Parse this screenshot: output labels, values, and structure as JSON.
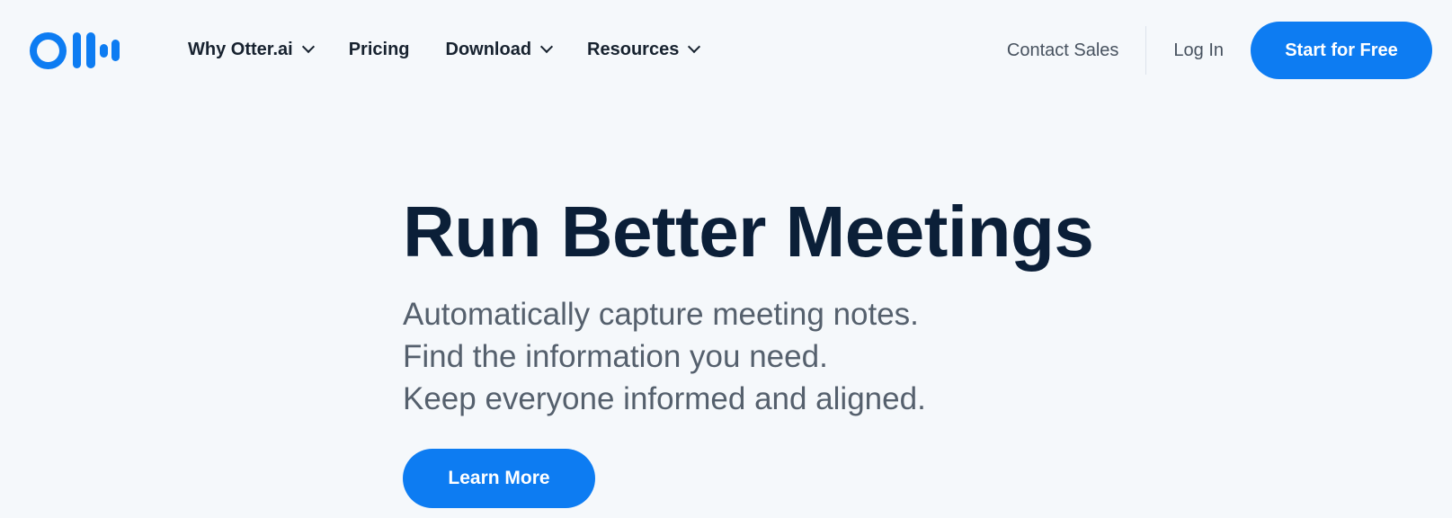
{
  "header": {
    "logo_icon": "otter-logo-icon",
    "nav": {
      "why": "Why Otter.ai",
      "pricing": "Pricing",
      "download": "Download",
      "resources": "Resources"
    },
    "contact_sales": "Contact Sales",
    "log_in": "Log In",
    "start_free": "Start for Free"
  },
  "hero": {
    "title": "Run Better Meetings",
    "lines": [
      "Automatically capture meeting notes.",
      "Find the information you need.",
      "Keep everyone informed and aligned."
    ],
    "cta": "Learn More"
  },
  "colors": {
    "background": "#f5f8fb",
    "accent": "#0d7cf2",
    "heading": "#0b1f38",
    "body_text": "#55606d"
  }
}
